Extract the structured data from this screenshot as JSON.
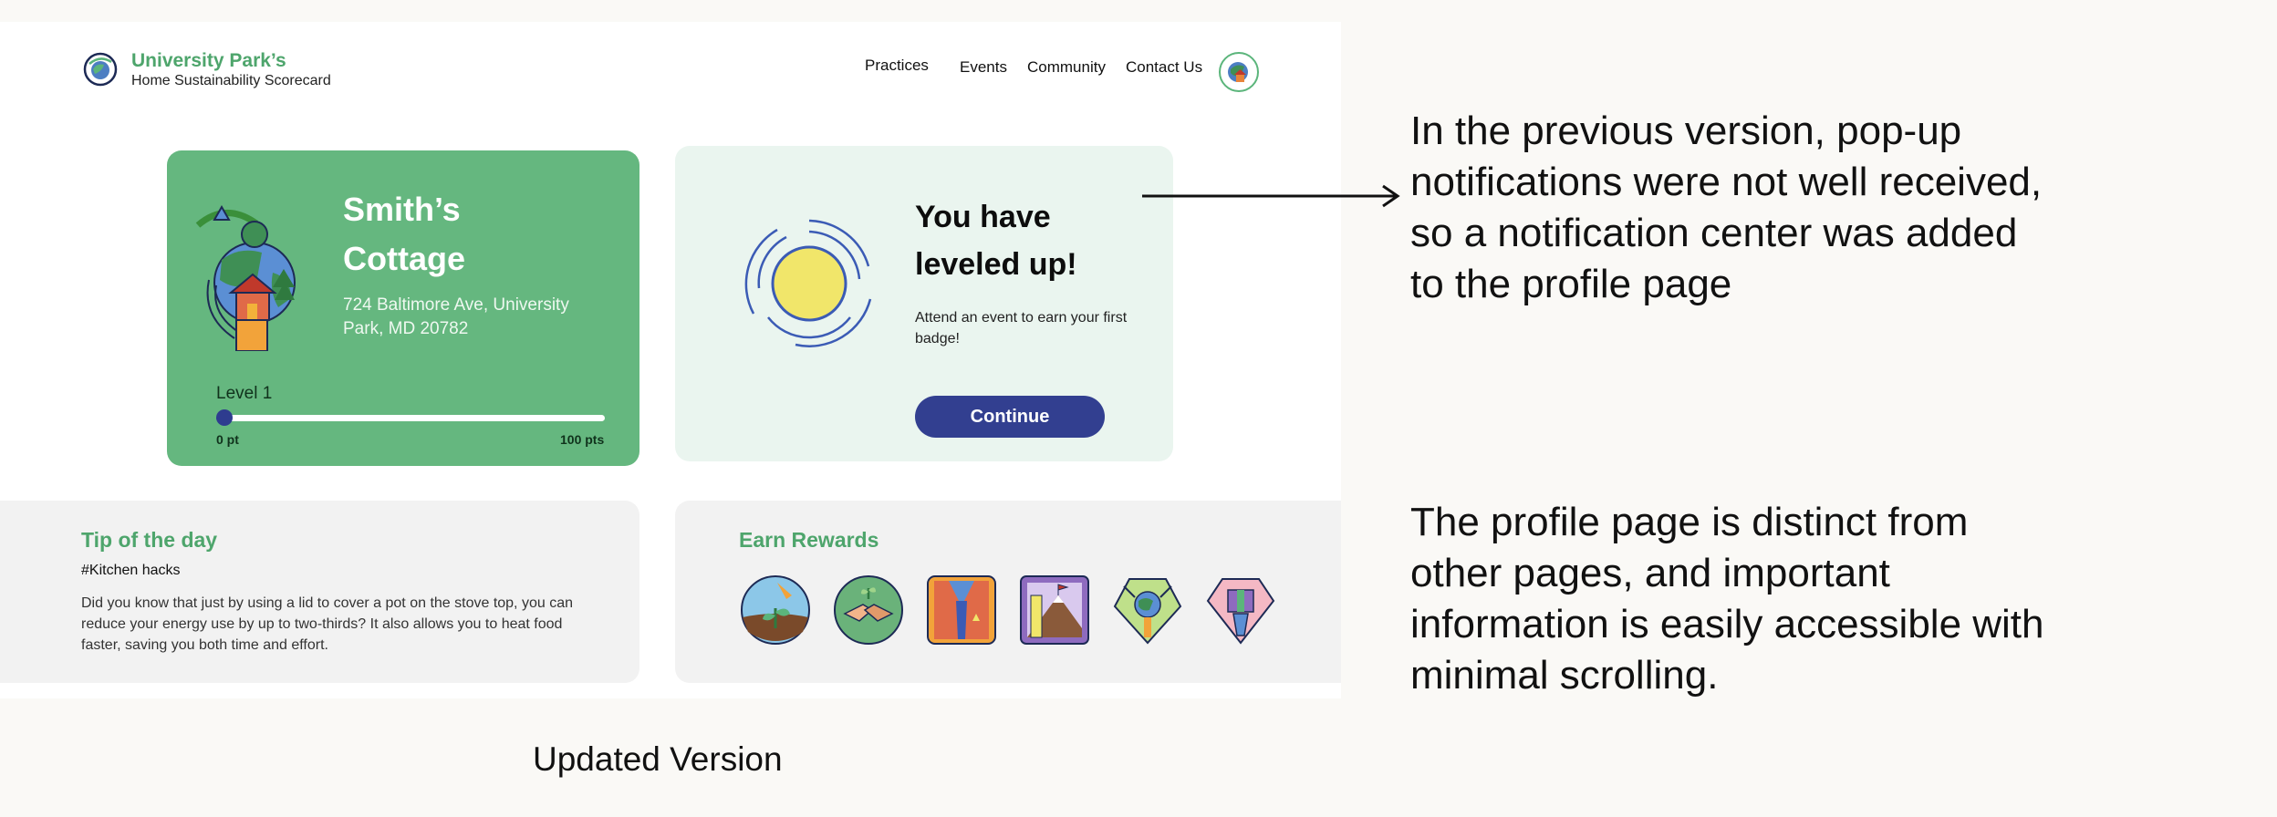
{
  "header": {
    "brand_name": "University Park’s",
    "brand_subtitle": "Home Sustainability Scorecard",
    "nav": [
      "Practices",
      "Events",
      "Community",
      "Contact Us"
    ]
  },
  "house": {
    "name": "Smith’s Cottage",
    "address": "724 Baltimore Ave, University Park, MD 20782",
    "level_label": "Level 1",
    "progress_min": "0 pt",
    "progress_max": "100 pts",
    "progress_fraction": 0.02
  },
  "notification": {
    "title": "You have leveled up!",
    "body": "Attend an event to earn your first badge!",
    "button": "Continue"
  },
  "tip": {
    "title": "Tip of the day",
    "tag": "#Kitchen hacks",
    "body": "Did you know that just by using a lid to cover a pot on the stove top, you can reduce your energy use by up to two-thirds? It also allows you to heat food faster, saving you both time and effort."
  },
  "rewards": {
    "title": "Earn Rewards",
    "badges": [
      "plant-badge-icon",
      "handshake-badge-icon",
      "water-badge-icon",
      "mountain-flag-badge-icon",
      "globe-badge-icon",
      "gift-badge-icon"
    ]
  },
  "caption": "Updated Version",
  "annotations": [
    "In the previous version, pop-up notifications were not well received, so a notification center was added to the profile page",
    "The profile page is distinct from other pages, and important information is easily accessible with minimal scrolling."
  ],
  "colors": {
    "brand_green": "#4ea56c",
    "card_green": "#65b77f",
    "notif_bg": "#eaf5ef",
    "button_blue": "#323f90",
    "sun_yellow": "#f1e66a"
  }
}
